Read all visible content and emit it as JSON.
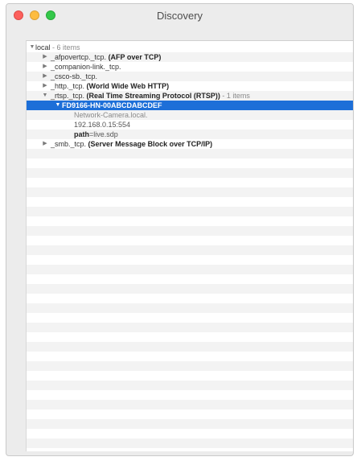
{
  "window": {
    "title": "Discovery"
  },
  "tree": {
    "root": {
      "label": "local",
      "count": " - 6 items"
    },
    "items": [
      {
        "name": "_afpovertcp._tcp.",
        "desc": "(AFP over TCP)"
      },
      {
        "name": "_companion-link._tcp.",
        "desc": ""
      },
      {
        "name": "_csco-sb._tcp.",
        "desc": ""
      },
      {
        "name": "_http._tcp.",
        "desc": "(World Wide Web HTTP)"
      },
      {
        "name": "_rtsp._tcp.",
        "desc": "(Real Time Streaming Protocol (RTSP))",
        "count": " - 1 items"
      },
      {
        "name": "_smb._tcp.",
        "desc": "(Server Message Block over TCP/IP)"
      }
    ],
    "device": {
      "name": "FD9166-HN-00ABCDABCDEF",
      "host": "Network-Camera.local.",
      "address": "192.168.0.15:554",
      "path_key": "path",
      "path_value": "=live.sdp"
    }
  },
  "icons": {
    "expanded": "disclosure-down",
    "collapsed": "disclosure-right"
  },
  "colors": {
    "selection": "#1d6fd8",
    "close": "#fc605c",
    "minimize": "#fdbc40",
    "zoom": "#34c84a"
  }
}
